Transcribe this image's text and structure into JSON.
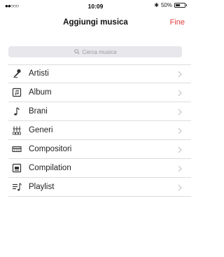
{
  "status_bar": {
    "signal": "●●○○○",
    "time": "10:09",
    "bluetooth": "✱",
    "battery_percent": "50%",
    "battery_level": 0.5
  },
  "nav": {
    "title": "Aggiungi musica",
    "done_label": "Fine",
    "accent_color": "#e23b3b"
  },
  "search": {
    "placeholder": "Cerca musica"
  },
  "list": {
    "items": [
      {
        "label": "Artisti",
        "icon": "microphone-icon"
      },
      {
        "label": "Album",
        "icon": "album-icon"
      },
      {
        "label": "Brani",
        "icon": "music-note-icon"
      },
      {
        "label": "Generi",
        "icon": "genres-icon"
      },
      {
        "label": "Compositori",
        "icon": "composers-icon"
      },
      {
        "label": "Compilation",
        "icon": "compilation-icon"
      },
      {
        "label": "Playlist",
        "icon": "playlist-icon"
      }
    ]
  }
}
